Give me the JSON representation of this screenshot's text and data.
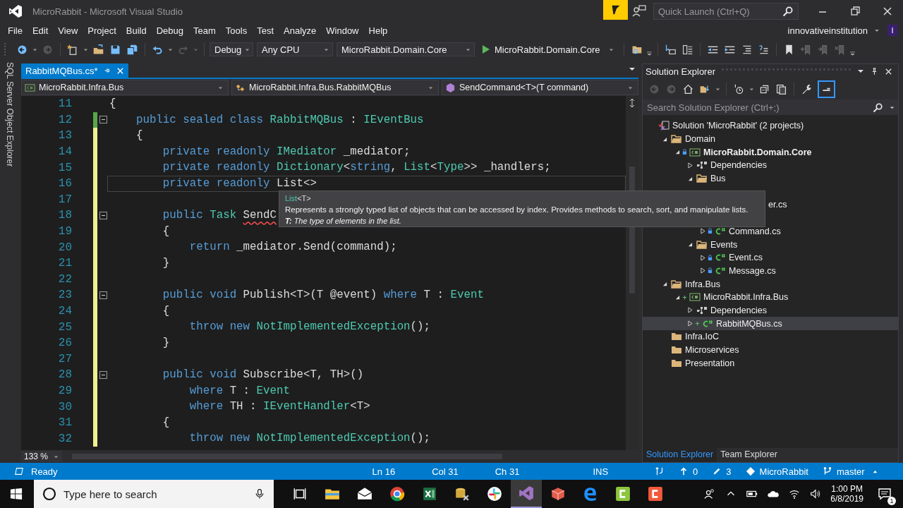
{
  "window": {
    "title": "MicroRabbit - Microsoft Visual Studio",
    "quick_launch": {
      "placeholder": "Quick Launch (Ctrl+Q)"
    }
  },
  "menu": [
    "File",
    "Edit",
    "View",
    "Project",
    "Build",
    "Debug",
    "Team",
    "Tools",
    "Test",
    "Analyze",
    "Window",
    "Help"
  ],
  "account": {
    "name": "innovativeinstitution",
    "initial": "I"
  },
  "toolbar": {
    "configuration": "Debug",
    "platform": "Any CPU",
    "startup_project": "MicroRabbit.Domain.Core",
    "run_target": "MicroRabbit.Domain.Core"
  },
  "side_strip": {
    "label": "SQL Server Object Explorer"
  },
  "editor": {
    "tabs": [
      {
        "label": "RabbitMQBus.cs*",
        "selected": true
      }
    ],
    "navigation": [
      "MicroRabbit.Infra.Bus",
      "MicroRabbit.Infra.Bus.RabbitMQBus",
      "SendCommand<T>(T command)"
    ],
    "zoom": "133 %",
    "lines": [
      {
        "number": "11",
        "modified": false,
        "saved": false,
        "current": false,
        "fold": false,
        "tokens": [
          {
            "text": "{",
            "kind": "plain"
          }
        ]
      },
      {
        "number": "12",
        "modified": true,
        "saved": true,
        "current": false,
        "fold": true,
        "tokens": [
          {
            "text": "    public sealed class ",
            "kind": "keyword"
          },
          {
            "text": "RabbitMQBus",
            "kind": "type"
          },
          {
            "text": " : ",
            "kind": "plain"
          },
          {
            "text": "IEventBus",
            "kind": "type"
          }
        ]
      },
      {
        "number": "13",
        "modified": true,
        "saved": false,
        "current": false,
        "fold": false,
        "tokens": [
          {
            "text": "    {",
            "kind": "plain"
          }
        ]
      },
      {
        "number": "14",
        "modified": true,
        "saved": false,
        "current": false,
        "fold": false,
        "tokens": [
          {
            "text": "        private readonly ",
            "kind": "keyword"
          },
          {
            "text": "IMediator",
            "kind": "type"
          },
          {
            "text": " _mediator;",
            "kind": "plain"
          }
        ]
      },
      {
        "number": "15",
        "modified": true,
        "saved": false,
        "current": false,
        "fold": false,
        "tokens": [
          {
            "text": "        private readonly ",
            "kind": "keyword"
          },
          {
            "text": "Dictionary",
            "kind": "type"
          },
          {
            "text": "<",
            "kind": "plain"
          },
          {
            "text": "string",
            "kind": "keyword"
          },
          {
            "text": ", ",
            "kind": "plain"
          },
          {
            "text": "List",
            "kind": "type"
          },
          {
            "text": "<",
            "kind": "plain"
          },
          {
            "text": "Type",
            "kind": "type"
          },
          {
            "text": ">> _handlers;",
            "kind": "plain"
          }
        ]
      },
      {
        "number": "16",
        "modified": true,
        "saved": false,
        "current": true,
        "fold": false,
        "tokens": [
          {
            "text": "        private readonly ",
            "kind": "keyword"
          },
          {
            "text": "List<>",
            "kind": "plain"
          }
        ]
      },
      {
        "number": "17",
        "modified": true,
        "saved": false,
        "current": false,
        "fold": false
      },
      {
        "number": "18",
        "modified": true,
        "saved": false,
        "current": false,
        "fold": true,
        "tokens": [
          {
            "text": "        public ",
            "kind": "keyword"
          },
          {
            "text": "Task ",
            "kind": "type"
          },
          {
            "text": "SendC",
            "kind": "plain",
            "error": true
          }
        ]
      },
      {
        "number": "19",
        "modified": true,
        "saved": false,
        "current": false,
        "fold": false,
        "tokens": [
          {
            "text": "        {",
            "kind": "plain"
          }
        ]
      },
      {
        "number": "20",
        "modified": true,
        "saved": false,
        "current": false,
        "fold": false,
        "tokens": [
          {
            "text": "            return ",
            "kind": "keyword"
          },
          {
            "text": "_mediator.Send(command);",
            "kind": "plain"
          }
        ]
      },
      {
        "number": "21",
        "modified": true,
        "saved": false,
        "current": false,
        "fold": false,
        "tokens": [
          {
            "text": "        }",
            "kind": "plain"
          }
        ]
      },
      {
        "number": "22",
        "modified": true,
        "saved": false,
        "current": false,
        "fold": false
      },
      {
        "number": "23",
        "modified": true,
        "saved": false,
        "current": false,
        "fold": true,
        "tokens": [
          {
            "text": "        public void ",
            "kind": "keyword"
          },
          {
            "text": "Publish<T>(T @event) ",
            "kind": "plain"
          },
          {
            "text": "where ",
            "kind": "keyword"
          },
          {
            "text": "T : ",
            "kind": "plain"
          },
          {
            "text": "Event",
            "kind": "type"
          }
        ]
      },
      {
        "number": "24",
        "modified": true,
        "saved": false,
        "current": false,
        "fold": false,
        "tokens": [
          {
            "text": "        {",
            "kind": "plain"
          }
        ]
      },
      {
        "number": "25",
        "modified": true,
        "saved": false,
        "current": false,
        "fold": false,
        "tokens": [
          {
            "text": "            throw new ",
            "kind": "keyword"
          },
          {
            "text": "NotImplementedException",
            "kind": "type"
          },
          {
            "text": "();",
            "kind": "plain"
          }
        ]
      },
      {
        "number": "26",
        "modified": true,
        "saved": false,
        "current": false,
        "fold": false,
        "tokens": [
          {
            "text": "        }",
            "kind": "plain"
          }
        ]
      },
      {
        "number": "27",
        "modified": true,
        "saved": false,
        "current": false,
        "fold": false
      },
      {
        "number": "28",
        "modified": true,
        "saved": false,
        "current": false,
        "fold": true,
        "tokens": [
          {
            "text": "        public void ",
            "kind": "keyword"
          },
          {
            "text": "Subscribe<T, TH>()",
            "kind": "plain"
          }
        ]
      },
      {
        "number": "29",
        "modified": true,
        "saved": false,
        "current": false,
        "fold": false,
        "tokens": [
          {
            "text": "            where ",
            "kind": "keyword"
          },
          {
            "text": "T : ",
            "kind": "plain"
          },
          {
            "text": "Event",
            "kind": "type"
          }
        ]
      },
      {
        "number": "30",
        "modified": true,
        "saved": false,
        "current": false,
        "fold": false,
        "tokens": [
          {
            "text": "            where ",
            "kind": "keyword"
          },
          {
            "text": "TH : ",
            "kind": "plain"
          },
          {
            "text": "IEventHandler",
            "kind": "type"
          },
          {
            "text": "<T>",
            "kind": "plain"
          }
        ]
      },
      {
        "number": "31",
        "modified": true,
        "saved": false,
        "current": false,
        "fold": false,
        "tokens": [
          {
            "text": "        {",
            "kind": "plain"
          }
        ]
      },
      {
        "number": "32",
        "modified": true,
        "saved": false,
        "current": false,
        "fold": false,
        "tokens": [
          {
            "text": "            throw new ",
            "kind": "keyword"
          },
          {
            "text": "NotImplementedException",
            "kind": "type"
          },
          {
            "text": "();",
            "kind": "plain"
          }
        ]
      }
    ],
    "tooltip": {
      "signature": [
        {
          "text": "List",
          "kind": "type"
        },
        {
          "text": "<T>",
          "kind": "plain"
        }
      ],
      "summary": "Represents a strongly typed list of objects that can be accessed by index. Provides methods to search, sort, and manipulate lists.",
      "param": "**T:** The type of elements in the list."
    }
  },
  "solution_explorer": {
    "title": "Solution Explorer",
    "search": {
      "placeholder": "Search Solution Explorer (Ctrl+;)"
    },
    "tree": [
      {
        "label": "Solution 'MicroRabbit' (2 projects)",
        "kind": "solution",
        "selected": false,
        "children": [
          {
            "label": "Domain",
            "kind": "folder",
            "expanded": true,
            "selected": false,
            "children": [
              {
                "label": "MicroRabbit.Domain.Core",
                "kind": "project",
                "checked_in": true,
                "startup": true,
                "expanded": true,
                "selected": false,
                "children": [
                  {
                    "label": "Dependencies",
                    "kind": "dependencies",
                    "expanded": false,
                    "selected": false
                  },
                  {
                    "label": "Bus",
                    "kind": "folder",
                    "expanded": true,
                    "selected": false,
                    "children": [
                      {
                        "label": "er.cs",
                        "kind": "clipped",
                        "selected": false
                      },
                      {
                        "label": "Command.cs",
                        "kind": "file",
                        "checked_in": true,
                        "expanded": false,
                        "selected": false
                      }
                    ]
                  },
                  {
                    "label": "Events",
                    "kind": "folder",
                    "expanded": true,
                    "selected": false,
                    "children": [
                      {
                        "label": "Event.cs",
                        "kind": "file",
                        "checked_in": true,
                        "expanded": false,
                        "selected": false
                      },
                      {
                        "label": "Message.cs",
                        "kind": "file",
                        "checked_in": true,
                        "expanded": false,
                        "selected": false
                      }
                    ]
                  }
                ]
              }
            ]
          },
          {
            "label": "Infra.Bus",
            "kind": "folder",
            "expanded": true,
            "selected": false,
            "children": [
              {
                "label": "MicroRabbit.Infra.Bus",
                "kind": "project",
                "checked_in": false,
                "startup": false,
                "expanded": true,
                "selected": false,
                "children": [
                  {
                    "label": "Dependencies",
                    "kind": "dependencies",
                    "expanded": false,
                    "selected": false
                  },
                  {
                    "label": "RabbitMQBus.cs",
                    "kind": "file",
                    "checked_in": false,
                    "expanded": false,
                    "selected": true
                  }
                ]
              }
            ]
          },
          {
            "label": "Infra.IoC",
            "kind": "closed_folder",
            "selected": false
          },
          {
            "label": "Microservices",
            "kind": "closed_folder",
            "selected": false
          },
          {
            "label": "Presentation",
            "kind": "closed_folder",
            "selected": false
          }
        ]
      }
    ],
    "tabs": [
      {
        "label": "Solution Explorer",
        "selected": true
      },
      {
        "label": "Team Explorer",
        "selected": false
      }
    ]
  },
  "status_bar": {
    "state": "Ready",
    "line": "Ln 16",
    "column": "Col 31",
    "char": "Ch 31",
    "mode": "INS",
    "unpushed": "0",
    "changes": "3",
    "repository": "MicroRabbit",
    "branch": "master"
  },
  "taskbar": {
    "search": {
      "placeholder": "Type here to search"
    },
    "time": "1:00 PM",
    "date": "6/8/2019",
    "notifications": "1"
  }
}
